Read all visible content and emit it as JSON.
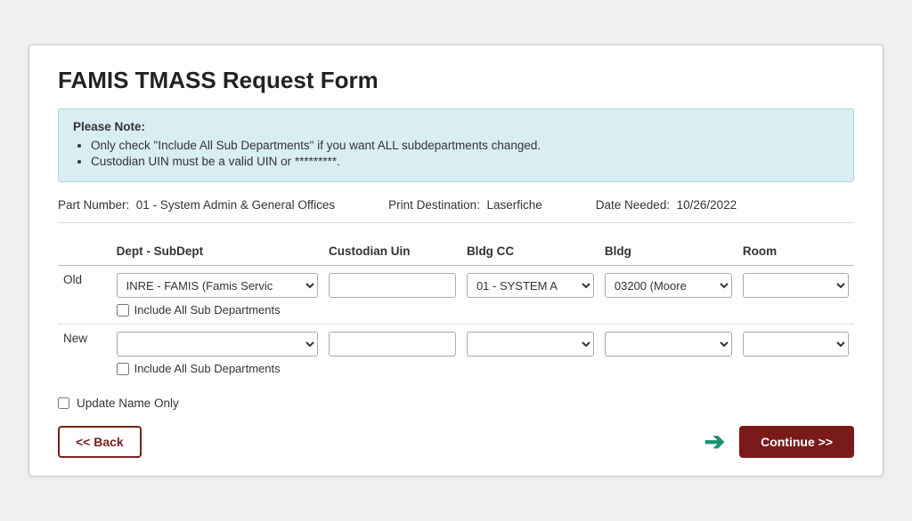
{
  "page": {
    "title": "FAMIS TMASS Request Form"
  },
  "notice": {
    "title": "Please Note:",
    "items": [
      "Only check \"Include All Sub Departments\" if you want ALL subdepartments changed.",
      "Custodian UIN must be a valid UIN or *********."
    ]
  },
  "meta": {
    "part_number_label": "Part Number:",
    "part_number_value": "01 - System Admin & General Offices",
    "print_destination_label": "Print Destination:",
    "print_destination_value": "Laserfiche",
    "date_needed_label": "Date Needed:",
    "date_needed_value": "10/26/2022"
  },
  "table": {
    "columns": {
      "dept_subdept": "Dept - SubDept",
      "custodian_uin": "Custodian Uin",
      "bldg_cc": "Bldg CC",
      "bldg": "Bldg",
      "room": "Room"
    },
    "old_row": {
      "label": "Old",
      "dept_value": "INRE - FAMIS (Famis Servic",
      "custodian_uin_value": "",
      "bldg_cc_value": "01 - SYSTEM A",
      "bldg_value": "03200 (Moore",
      "room_value": "",
      "include_all_label": "Include All Sub Departments"
    },
    "new_row": {
      "label": "New",
      "dept_value": "",
      "custodian_uin_value": "",
      "bldg_cc_value": "",
      "bldg_value": "",
      "room_value": "",
      "include_all_label": "Include All Sub Departments"
    }
  },
  "update_name_only": {
    "label": "Update Name Only"
  },
  "buttons": {
    "back": "<< Back",
    "continue": "Continue >>"
  }
}
